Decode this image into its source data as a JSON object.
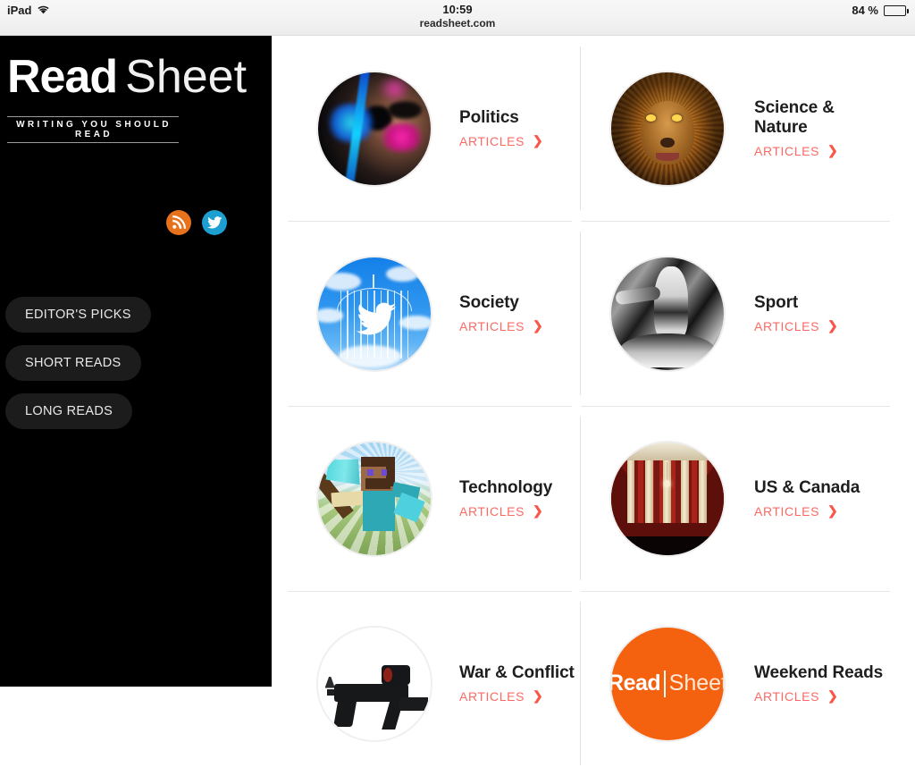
{
  "status_bar": {
    "device": "iPad",
    "wifi_icon": "wifi-icon",
    "time": "10:59",
    "url": "readsheet.com",
    "battery_percent": "84 %",
    "battery_level": 84
  },
  "sidebar": {
    "logo": {
      "primary": "Read",
      "secondary": "Sheet",
      "tagline": "WRITING YOU SHOULD READ"
    },
    "social": [
      {
        "name": "rss-button",
        "icon": "rss-icon",
        "color": "#e8721c"
      },
      {
        "name": "twitter-button",
        "icon": "twitter-icon",
        "color": "#1da0d1"
      }
    ],
    "pills": [
      {
        "label": "EDITOR'S PICKS"
      },
      {
        "label": "SHORT READS"
      },
      {
        "label": "LONG READS"
      }
    ]
  },
  "content": {
    "link_label": "ARTICLES",
    "chevron": "❯",
    "accent_color": "#fb6a64",
    "categories": [
      {
        "title": "Politics",
        "thumb": "politics-neon-face-image"
      },
      {
        "title": "Science & Nature",
        "thumb": "lion-portrait-image"
      },
      {
        "title": "Society",
        "thumb": "twitter-bird-cage-image"
      },
      {
        "title": "Sport",
        "thumb": "vintage-boxing-image"
      },
      {
        "title": "Technology",
        "thumb": "minecraft-steve-image"
      },
      {
        "title": "US & Canada",
        "thumb": "supreme-court-columns-image"
      },
      {
        "title": "War & Conflict",
        "thumb": "assault-rifle-image"
      },
      {
        "title": "Weekend Reads",
        "thumb": "readsheet-orange-logo-image"
      }
    ]
  }
}
